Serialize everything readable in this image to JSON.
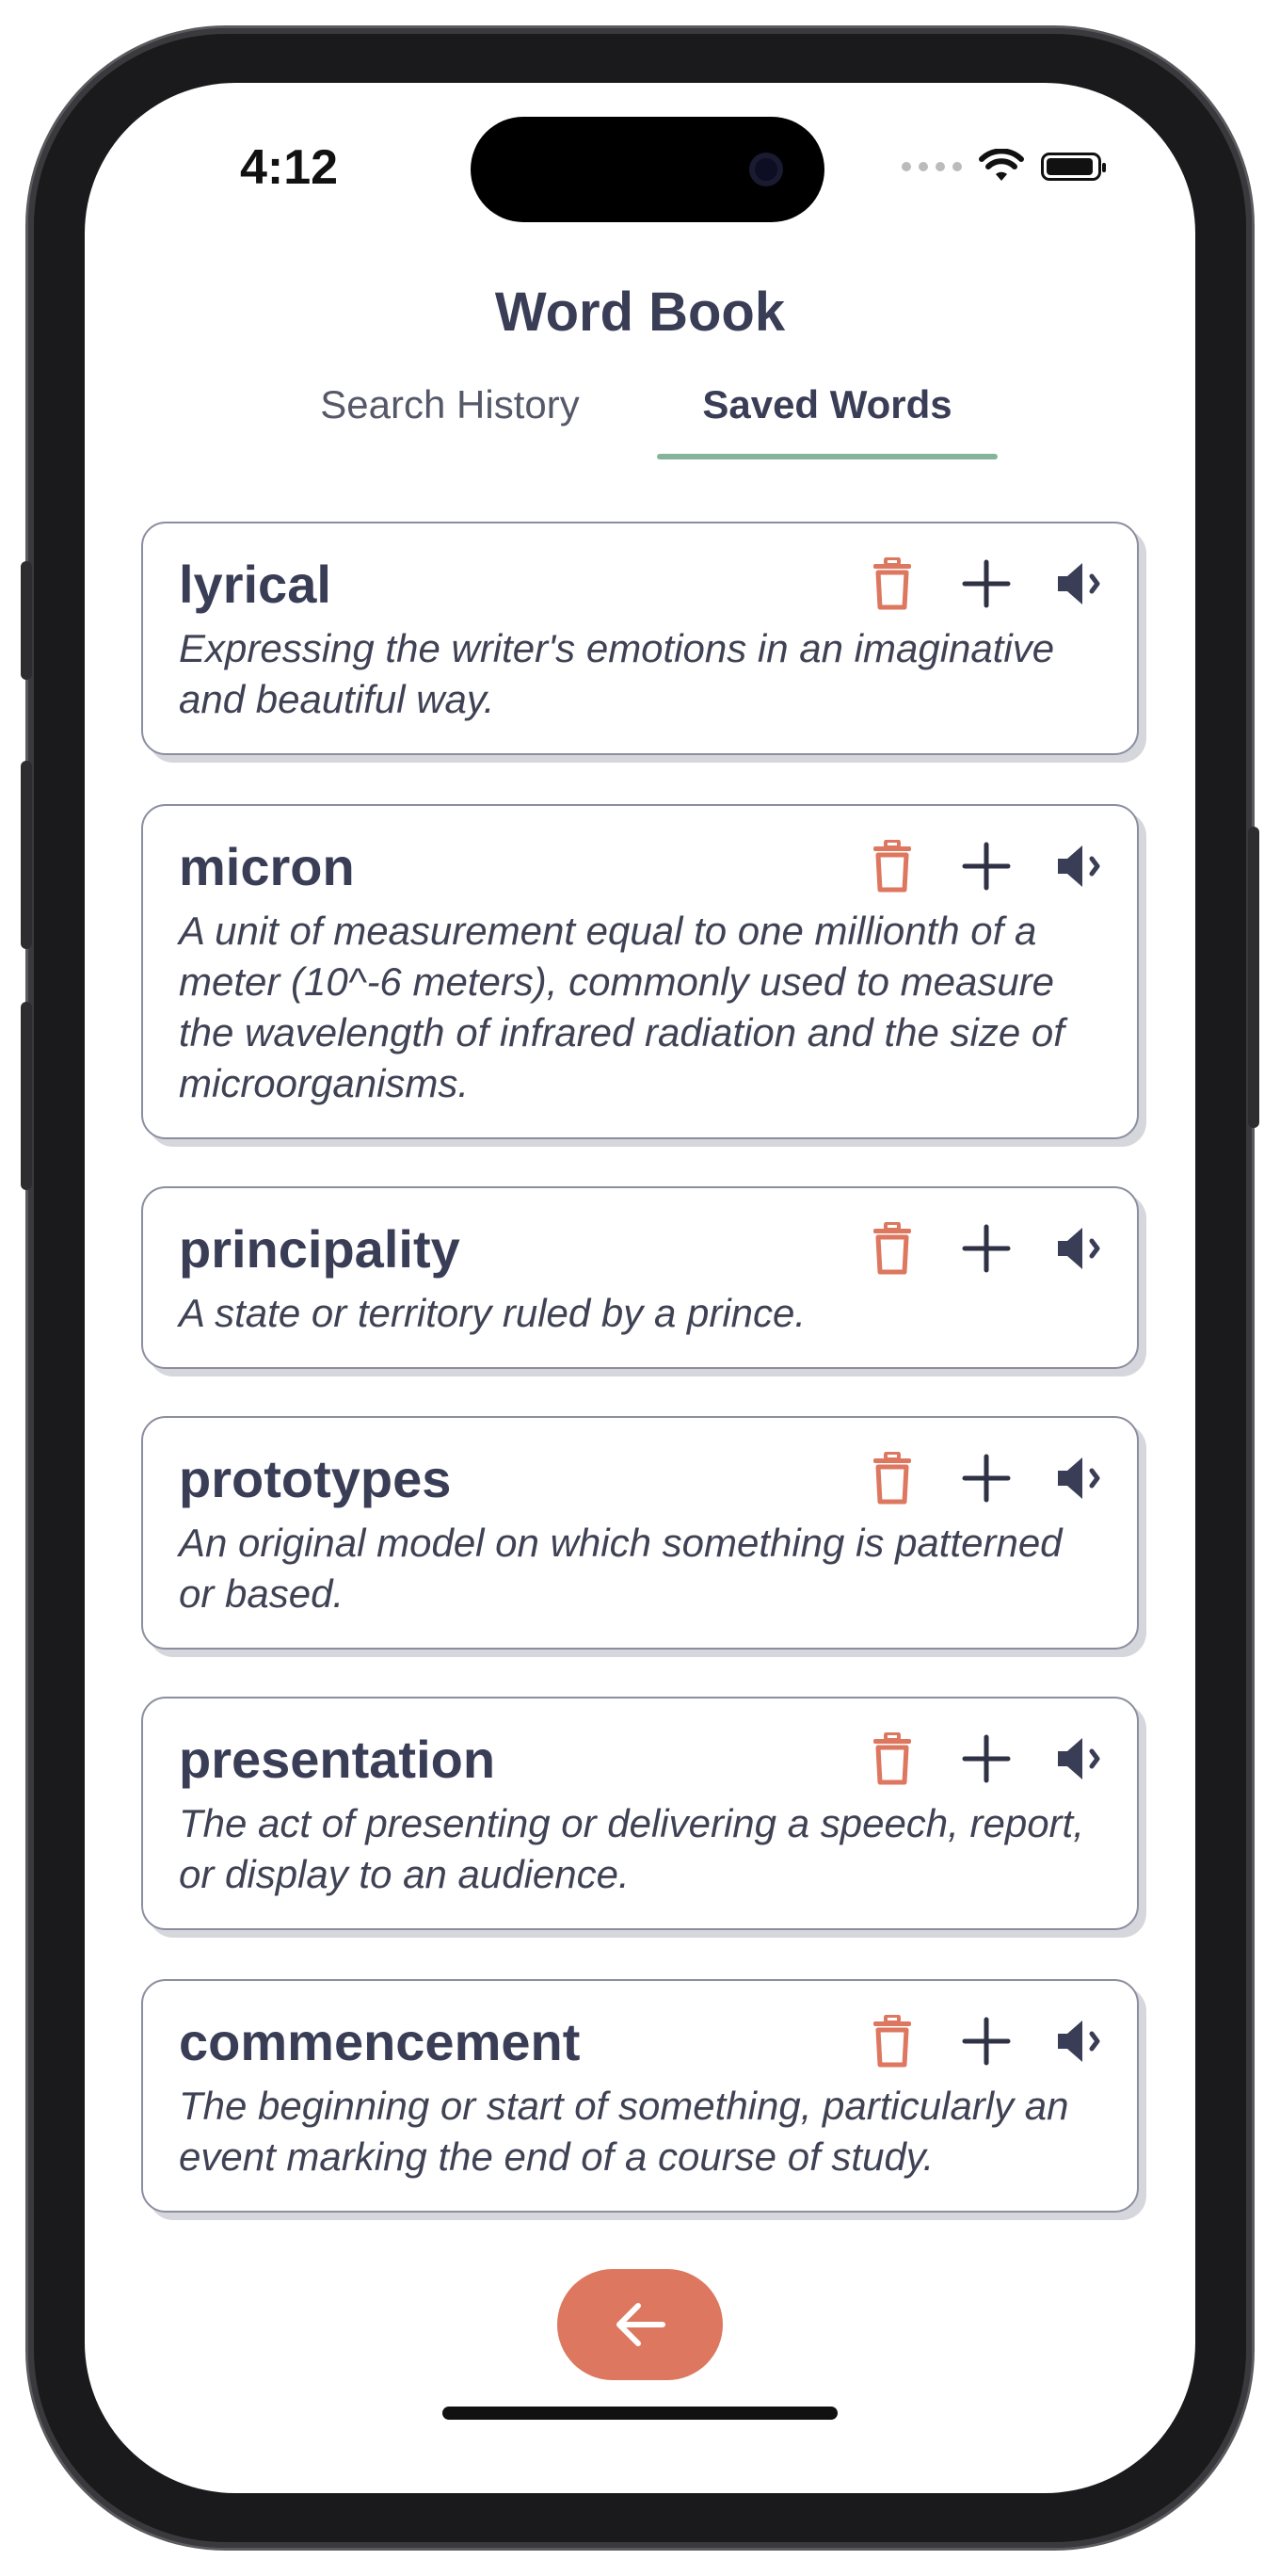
{
  "status_bar": {
    "time": "4:12"
  },
  "header": {
    "title": "Word Book"
  },
  "tabs": [
    {
      "label": "Search History",
      "active": false
    },
    {
      "label": "Saved Words",
      "active": true
    }
  ],
  "colors": {
    "title_text": "#3a3d56",
    "delete_icon": "#dd775f",
    "tab_underline": "#86b49a",
    "back_button": "#dd775f"
  },
  "words": [
    {
      "word": "lyrical",
      "definition": "Expressing the writer's emotions in an imaginative and beautiful way."
    },
    {
      "word": "micron",
      "definition": "A unit of measurement equal to one millionth of a meter (10^-6 meters), commonly used to measure the wavelength of infrared radiation and the size of microorganisms."
    },
    {
      "word": "principality",
      "definition": "A state or territory ruled by a prince."
    },
    {
      "word": "prototypes",
      "definition": "An original model on which something is patterned or based."
    },
    {
      "word": "presentation",
      "definition": "The act of presenting or delivering a speech, report, or display to an audience."
    },
    {
      "word": "commencement",
      "definition": "The beginning or start of something, particularly an event marking the end of a course of study."
    }
  ],
  "card_icons": [
    "trash-icon",
    "plus-icon",
    "speaker-icon"
  ],
  "footer": {
    "back_icon": "arrow-left-icon"
  }
}
